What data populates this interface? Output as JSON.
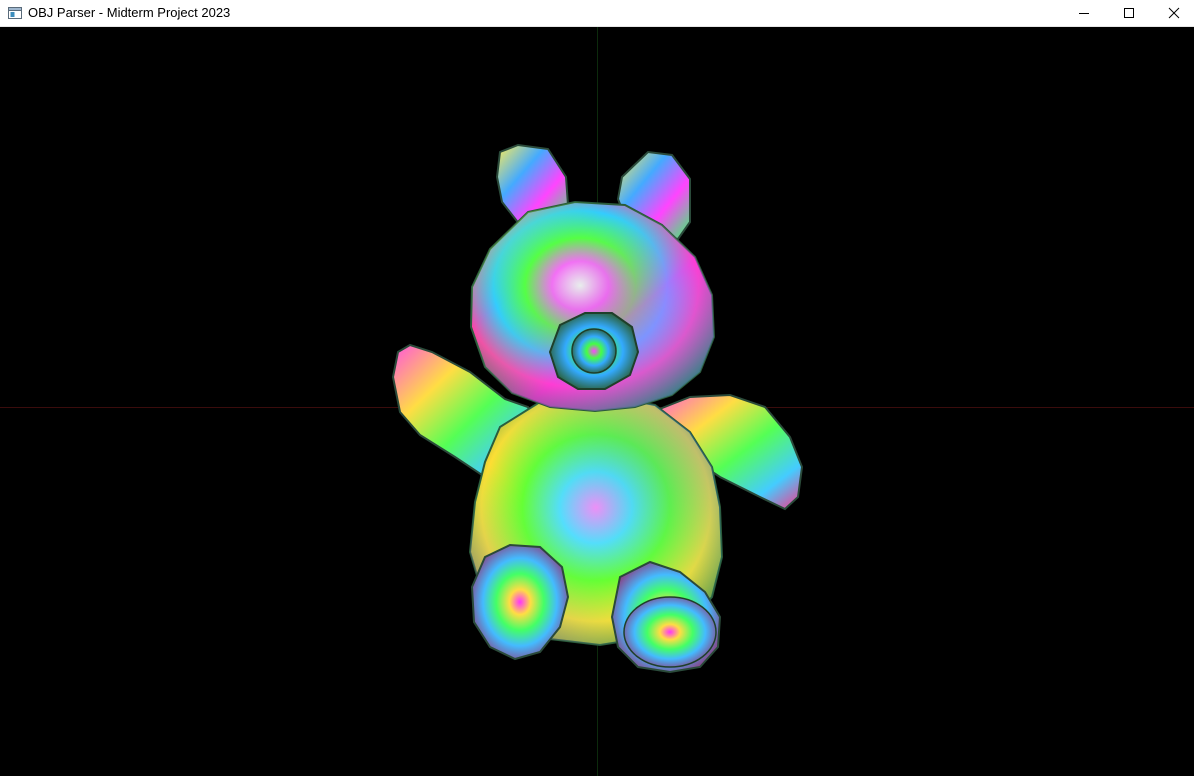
{
  "window": {
    "title": "OBJ Parser - Midterm Project 2023",
    "controls": {
      "minimize_icon": "minimize-icon",
      "maximize_icon": "maximize-icon",
      "close_icon": "close-icon"
    }
  },
  "viewport": {
    "background": "#000000",
    "axis_x_color": "#3a0c0c",
    "axis_y_color": "#0c2a0c",
    "model": "teddy-bear-mesh"
  }
}
